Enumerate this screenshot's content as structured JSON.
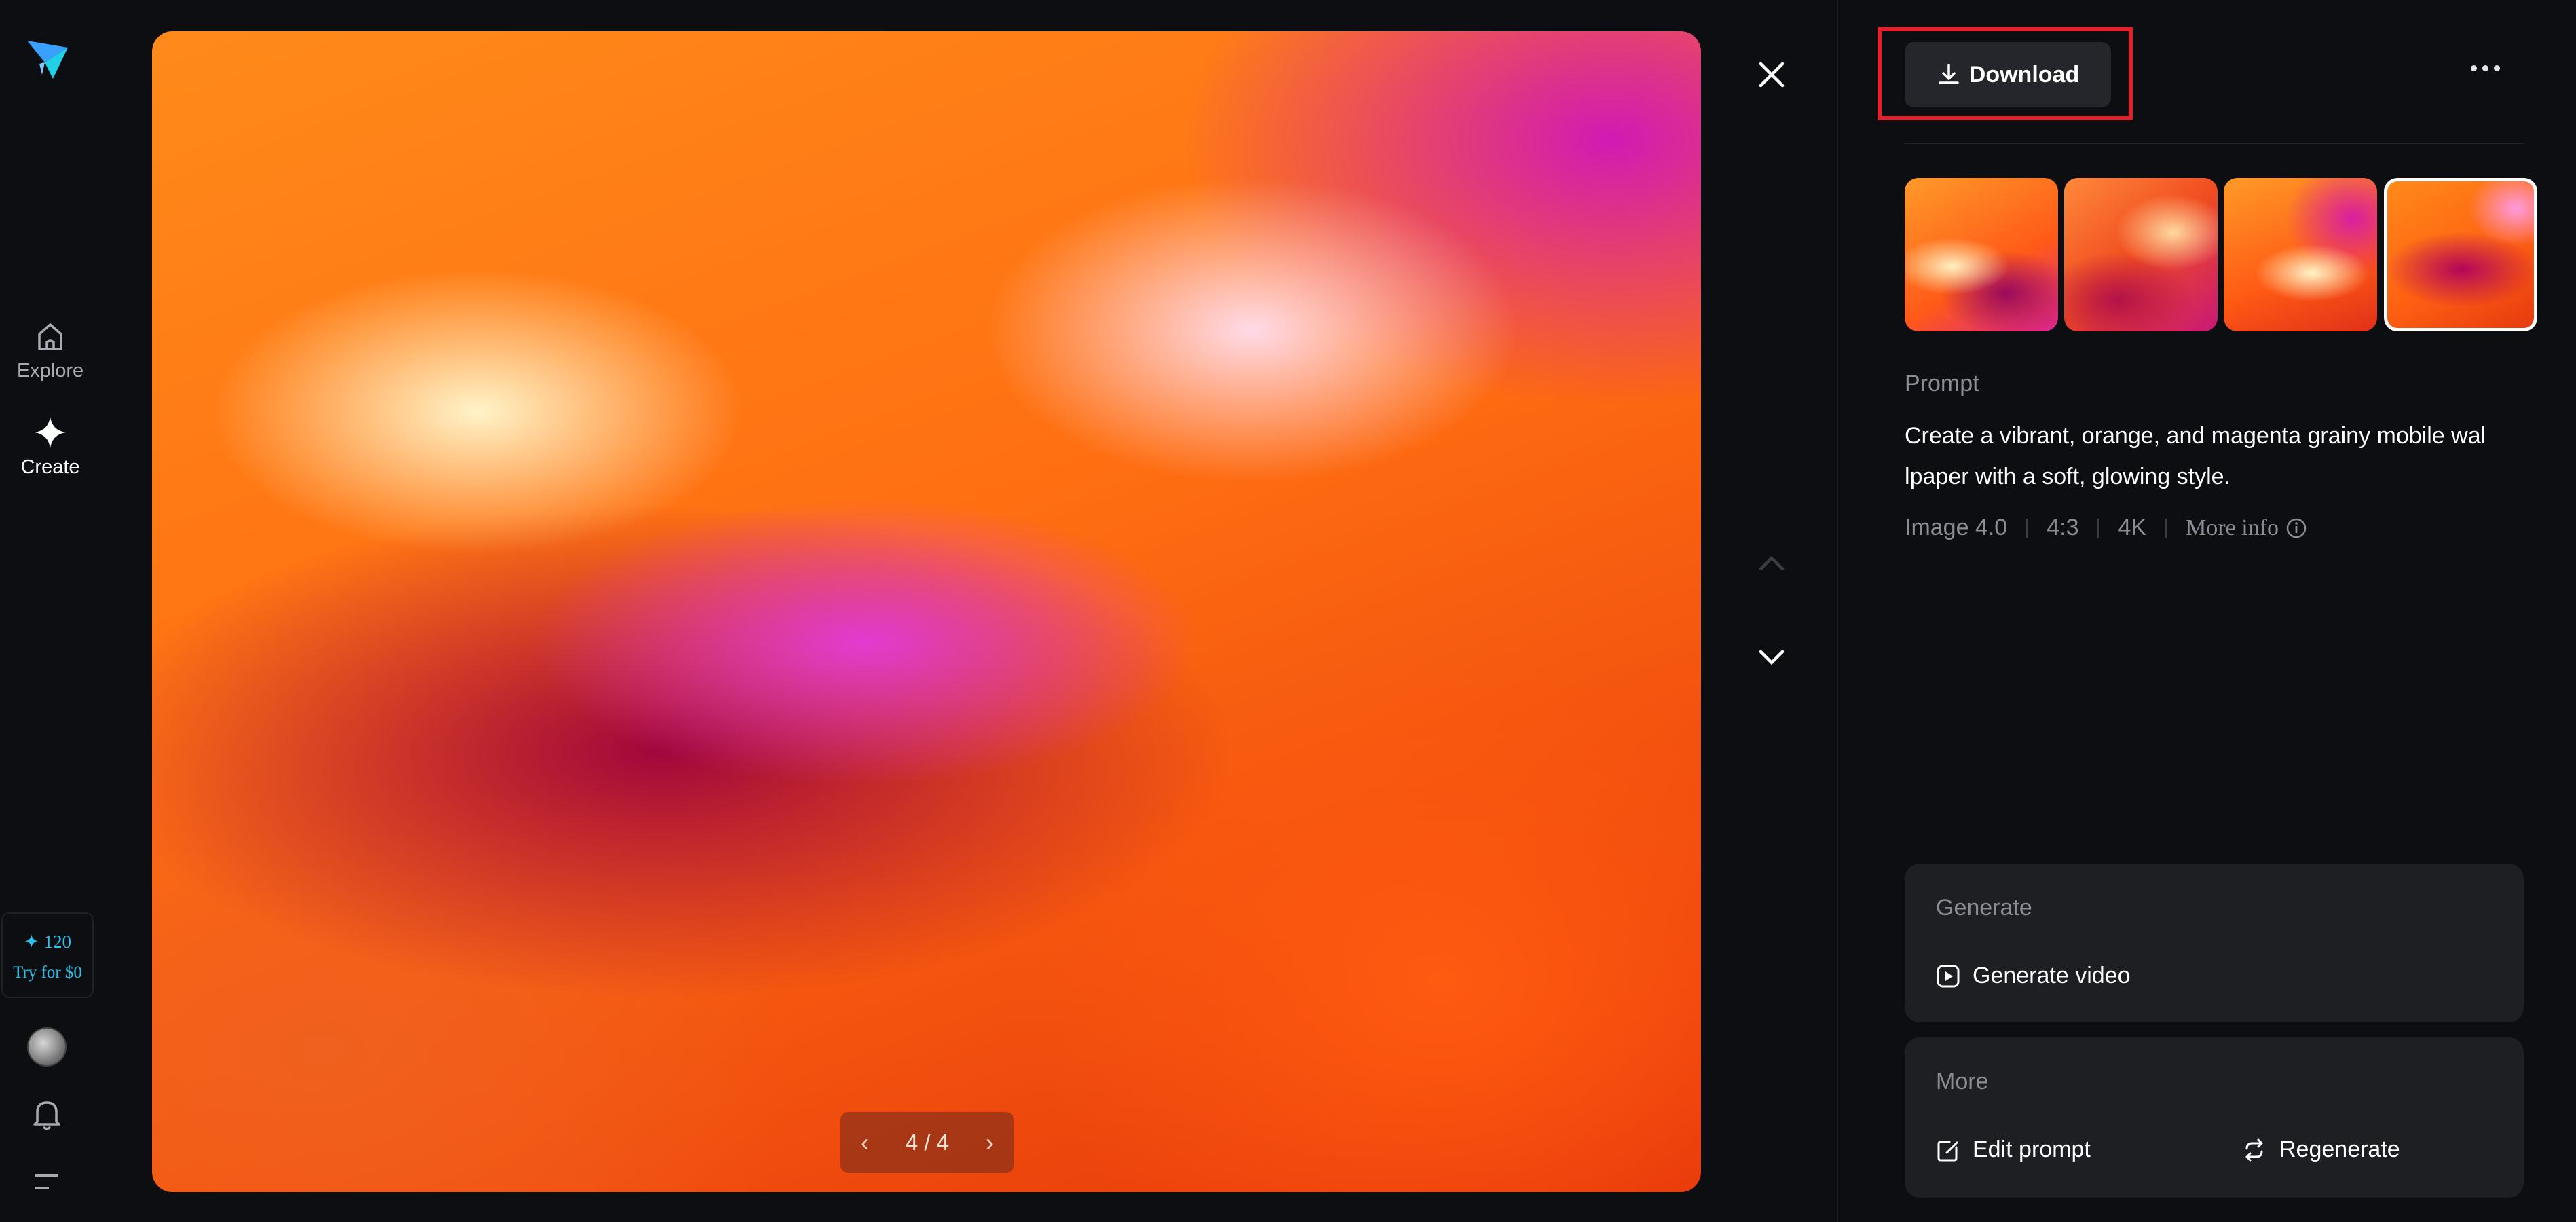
{
  "sidebar": {
    "logo_icon": "paper-plane-star-logo",
    "items": [
      {
        "label": "Explore",
        "icon": "home-icon"
      },
      {
        "label": "Create",
        "icon": "sparkle-icon"
      }
    ],
    "credits": {
      "count": "120",
      "cta": "Try for $0"
    },
    "bell_icon": "bell-icon",
    "menu_icon": "menu-icon"
  },
  "viewer": {
    "pager_text": "4 / 4",
    "prev_icon": "chevron-left-icon",
    "next_icon": "chevron-right-icon"
  },
  "panel": {
    "download_label": "Download",
    "more_icon": "more-horizontal-icon",
    "thumbnails_selected": 4,
    "prompt_label": "Prompt",
    "prompt_text": "Create a vibrant, orange, and magenta grainy mobile wal lpaper with a soft, glowing style.",
    "meta": {
      "model": "Image 4.0",
      "ratio": "4:3",
      "resolution": "4K",
      "more_info": "More info"
    },
    "generate_card": {
      "title": "Generate",
      "actions": [
        {
          "label": "Generate video",
          "icon": "play-square-icon"
        }
      ]
    },
    "more_card": {
      "title": "More",
      "actions": [
        {
          "label": "Edit prompt",
          "icon": "edit-icon"
        },
        {
          "label": "Regenerate",
          "icon": "refresh-icon"
        }
      ]
    }
  },
  "colors": {
    "background": "#0d0e11",
    "card": "#1e1f23",
    "accent": "#27c3ec",
    "highlight": "#e3212b"
  }
}
